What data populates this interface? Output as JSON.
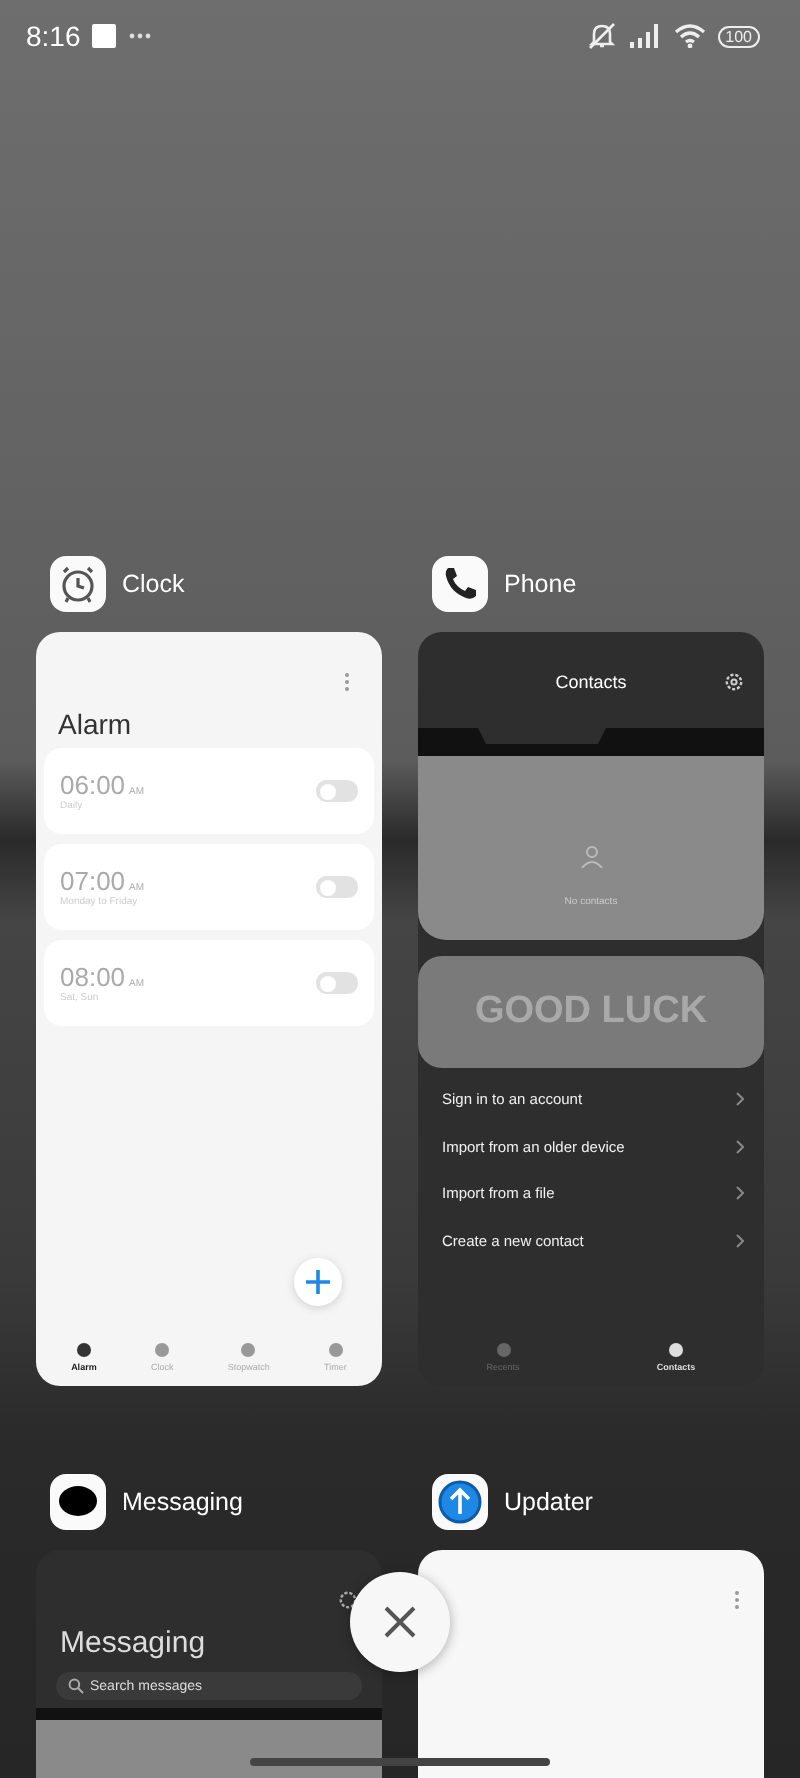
{
  "status_bar": {
    "time": "8:16",
    "battery": "100"
  },
  "apps": [
    {
      "kind": "clock",
      "name": "Clock",
      "title": "Alarm",
      "alarms": [
        {
          "time": "06:00",
          "ampm": "AM",
          "repeat": "Daily",
          "on": false
        },
        {
          "time": "07:00",
          "ampm": "AM",
          "repeat": "Monday to Friday",
          "on": false
        },
        {
          "time": "08:00",
          "ampm": "AM",
          "repeat": "Sat, Sun",
          "on": false
        }
      ],
      "nav": [
        {
          "label": "Alarm",
          "selected": true
        },
        {
          "label": "Clock",
          "selected": false
        },
        {
          "label": "Stopwatch",
          "selected": false
        },
        {
          "label": "Timer",
          "selected": false
        }
      ]
    },
    {
      "kind": "phone",
      "name": "Phone",
      "title": "Contacts",
      "empty": "No contacts",
      "banner": "GOOD LUCK",
      "actions": [
        "Sign in to an account",
        "Import from an older device",
        "Import from a file",
        "Create a new contact"
      ],
      "nav": [
        {
          "label": "Recents",
          "selected": false
        },
        {
          "label": "Contacts",
          "selected": true
        }
      ]
    },
    {
      "kind": "messaging",
      "name": "Messaging",
      "title": "Messaging",
      "search": {
        "placeholder": "Search messages"
      }
    },
    {
      "kind": "updater",
      "name": "Updater"
    }
  ]
}
